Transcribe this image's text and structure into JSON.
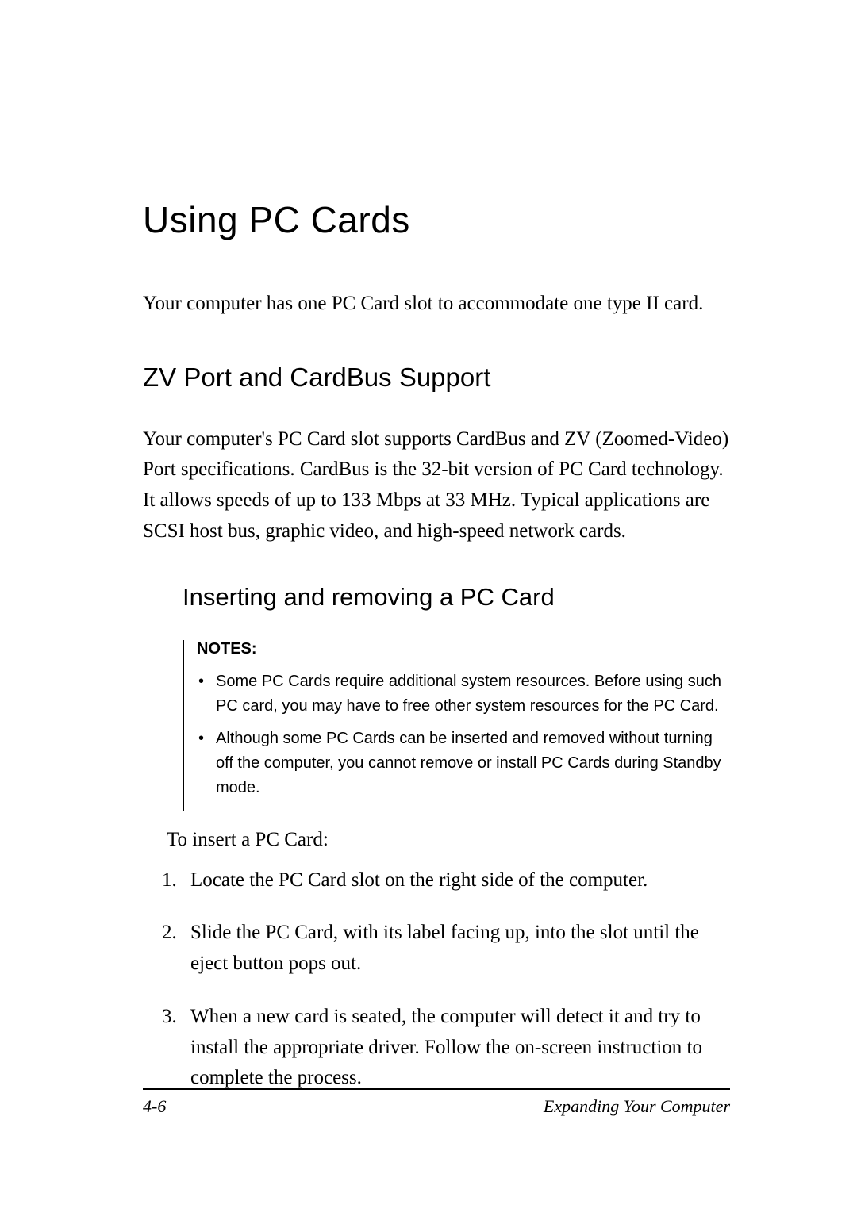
{
  "h1": "Using PC Cards",
  "intro": "Your computer has one PC Card slot to accommodate one type II card.",
  "h2": "ZV Port and CardBus Support",
  "para1": "Your computer's PC Card slot supports CardBus and ZV (Zoomed-Video) Port specifications. CardBus is the 32-bit version of PC Card technology. It allows speeds of up to 133 Mbps at 33 MHz. Typical applications are SCSI host bus, graphic video, and high-speed network cards.",
  "h3": "Inserting and removing a PC Card",
  "notes": {
    "title": "NOTES:",
    "items": [
      "Some PC Cards require additional system resources. Before using such PC card, you may have to free other system resources for the PC Card.",
      "Although some PC Cards can be inserted and removed without turning off the computer, you cannot remove or install PC Cards during Standby mode."
    ]
  },
  "subintro": "To insert a PC Card:",
  "steps": [
    "Locate the PC Card slot on the right side of the computer.",
    "Slide the PC Card, with its label facing up, into the slot until the eject button pops out.",
    "When a new card is seated, the computer will detect it and try to install the appropriate driver. Follow the on-screen instruction to complete the process."
  ],
  "footer": {
    "pagenum": "4-6",
    "section": "Expanding Your Computer"
  }
}
